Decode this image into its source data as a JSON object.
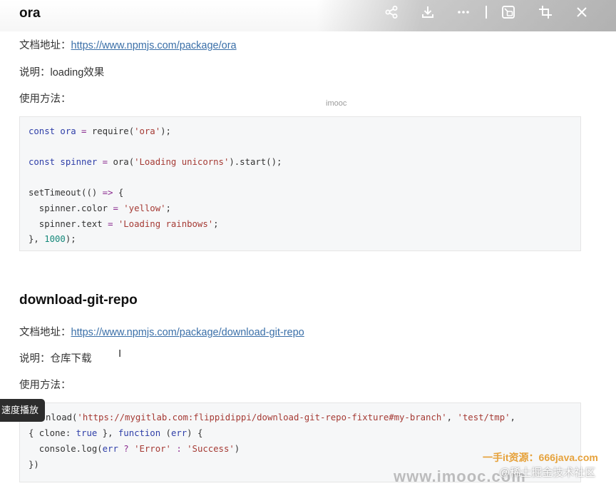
{
  "toolbar": {
    "icons": [
      "share-icon",
      "download-icon",
      "more-icon",
      "picture-in-picture-icon",
      "crop-icon",
      "close-icon"
    ]
  },
  "sections": [
    {
      "title": "ora",
      "doc_label": "文档地址：",
      "doc_url": "https://www.npmjs.com/package/ora",
      "desc_label": "说明：",
      "desc": "loading效果",
      "usage_label": "使用方法："
    },
    {
      "title": "download-git-repo",
      "doc_label": "文档地址：",
      "doc_url": "https://www.npmjs.com/package/download-git-repo",
      "desc_label": "说明：",
      "desc": "仓库下载",
      "usage_label": "使用方法："
    }
  ],
  "code1": {
    "l1a": "const ",
    "l1b": "ora",
    "l1c": " = ",
    "l1d": "require",
    "l1e": "(",
    "l1f": "'ora'",
    "l1g": ");",
    "l2a": "const ",
    "l2b": "spinner",
    "l2c": " = ",
    "l2d": "ora",
    "l2e": "(",
    "l2f": "'Loading unicorns'",
    "l2g": ").start();",
    "l3a": "setTimeout",
    "l3b": "(() ",
    "l3c": "=>",
    "l3d": " {",
    "l4a": "  spinner.color ",
    "l4b": "=",
    "l4c": " ",
    "l4d": "'yellow'",
    "l4e": ";",
    "l5a": "  spinner.text ",
    "l5b": "=",
    "l5c": " ",
    "l5d": "'Loading rainbows'",
    "l5e": ";",
    "l6a": "}, ",
    "l6b": "1000",
    "l6c": ");"
  },
  "code2": {
    "l1a": "nload(",
    "l1b": "'https://mygitlab.com:flippidippi/download-git-repo-fixture#my-branch'",
    "l1c": ", ",
    "l1d": "'test/tmp'",
    "l1e": ",",
    "l2a": "{ clone: ",
    "l2b": "true",
    "l2c": " }, ",
    "l2d": "function",
    "l2e": " (",
    "l2f": "err",
    "l2g": ") {",
    "l3a": "  console.log(",
    "l3b": "err",
    "l3c": " ? ",
    "l3d": "'Error'",
    "l3e": " : ",
    "l3f": "'Success'",
    "l3g": ")",
    "l4a": "})"
  },
  "overlays": {
    "watermark_top": "imooc",
    "speed_tip": "速度播放",
    "watermark_bottom": "www.imooc.com",
    "watermark_orange": "一手it资源：666java.com",
    "watermark_juejin": "@稀土掘金技术社区"
  }
}
